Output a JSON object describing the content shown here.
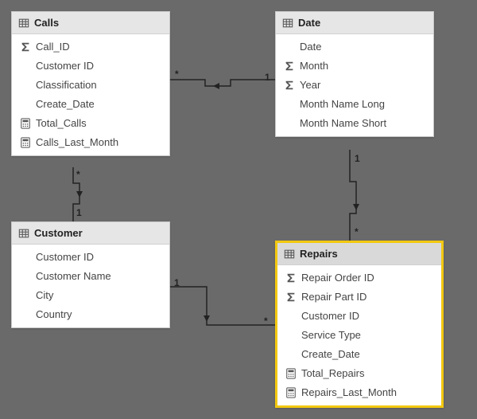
{
  "tables": {
    "calls": {
      "title": "Calls",
      "fields": [
        {
          "icon": "sigma",
          "label": "Call_ID"
        },
        {
          "icon": "none",
          "label": "Customer ID"
        },
        {
          "icon": "none",
          "label": "Classification"
        },
        {
          "icon": "none",
          "label": "Create_Date"
        },
        {
          "icon": "calc",
          "label": "Total_Calls"
        },
        {
          "icon": "calc",
          "label": "Calls_Last_Month"
        }
      ]
    },
    "date": {
      "title": "Date",
      "fields": [
        {
          "icon": "none",
          "label": "Date"
        },
        {
          "icon": "sigma",
          "label": "Month"
        },
        {
          "icon": "sigma",
          "label": "Year"
        },
        {
          "icon": "none",
          "label": "Month Name Long"
        },
        {
          "icon": "none",
          "label": "Month Name Short"
        }
      ]
    },
    "customer": {
      "title": "Customer",
      "fields": [
        {
          "icon": "none",
          "label": "Customer ID"
        },
        {
          "icon": "none",
          "label": "Customer Name"
        },
        {
          "icon": "none",
          "label": "City"
        },
        {
          "icon": "none",
          "label": "Country"
        }
      ]
    },
    "repairs": {
      "title": "Repairs",
      "fields": [
        {
          "icon": "sigma",
          "label": "Repair Order ID"
        },
        {
          "icon": "sigma",
          "label": "Repair Part ID"
        },
        {
          "icon": "none",
          "label": "Customer ID"
        },
        {
          "icon": "none",
          "label": "Service Type"
        },
        {
          "icon": "none",
          "label": "Create_Date"
        },
        {
          "icon": "calc",
          "label": "Total_Repairs"
        },
        {
          "icon": "calc",
          "label": "Repairs_Last_Month"
        }
      ]
    }
  },
  "relationships": {
    "calls_date": {
      "many": "*",
      "one": "1"
    },
    "calls_customer": {
      "many": "*",
      "one": "1"
    },
    "customer_repairs": {
      "one": "1",
      "many": "*"
    },
    "date_repairs": {
      "one": "1",
      "many": "*"
    }
  }
}
